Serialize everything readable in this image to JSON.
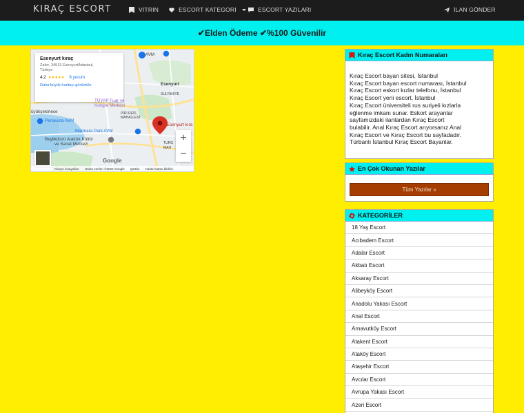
{
  "navbar": {
    "brand": "KIRAÇ ESCORT",
    "items": [
      {
        "label": "VITRIN",
        "icon": "bookmark-icon"
      },
      {
        "label": "ESCORT KATEGORI",
        "icon": "heart-icon"
      },
      {
        "label": "ESCORT YAZILARI",
        "icon": "comment-icon"
      },
      {
        "label": "İLAN GÖNDER",
        "icon": "paper-plane-icon"
      }
    ]
  },
  "banner": {
    "text": "✔Elden Ödeme ✔%100 Güvenilir"
  },
  "map": {
    "card": {
      "title": "Esenyurt kıraç",
      "address_line1": "Zafer, 34513 Esenyurt/İstanbul,",
      "address_line2": "Türkiye",
      "rating": "4,2",
      "stars": "★★★★★",
      "reviews": "6 yorum",
      "bigger_map": "Daha büyük haritayı görüntüle"
    },
    "labels": {
      "avm_top": "AVM",
      "esenyurt": "Esenyurt",
      "sultaniye": "SULTANİYE",
      "tuyap": "TÜYAP Fuar ve",
      "kongre": "Kongre Merkezi",
      "pirireis": "PİRİ REİS",
      "mahallesi": "MAHALLESİ",
      "buyukcekmece": "üyükçekmece",
      "perlavista": "Perlavista AVM",
      "marmara": "Marmara Park AVM",
      "pin_label": "Esenyurt kıra",
      "beylikduzu": "Beylikdüzü Atatürk Kültür",
      "sanat": "ve Sanat Merkezi",
      "turg": "TURG",
      "mah": "MAH"
    },
    "zoom_in": "+",
    "zoom_out": "−",
    "google": "Google",
    "attribution": [
      "Klavye kısayolları",
      "Harita verileri ©2024 Google",
      "Şartlar",
      "Harita hatası bildirin"
    ],
    "colors": {
      "water": "#a6d4f0",
      "land": "#eceff1",
      "park": "#cde8c8",
      "road": "#fde293",
      "pin": "#d93025"
    }
  },
  "sidebar": {
    "numbers": {
      "title": "Kıraç Escort Kadın Numaraları",
      "lines": [
        "Kıraç Escort bayan sitesi, İstanbul",
        "Kıraç Escort bayan escort numarası, İstanbul",
        "Kıraç Escort eskort kızlar telefonu, İstanbul",
        "Kıraç Escort yeni escort, İstanbul",
        "Kıraç Escort üniversiteli rus suriyeli kızlarla",
        "eğlenme imkanı sunar. Eskort arayanlar",
        "sayfamızdaki ilanlardan Kıraç Escort",
        "bulabilir. Anal Kıraç  Escort arıyorsanız Anal",
        "Kıraç Escort ve Kıraç Escort bu sayfadadır.",
        "Türbanlı İstanbul Kıraç Escort Bayanlar."
      ]
    },
    "popular": {
      "title": "En Çok Okunan Yazılar",
      "button": "Tüm Yazılar »"
    },
    "categories": {
      "title": "KATEGORİLER",
      "items": [
        "18 Yaş Escort",
        "Acıbadem Escort",
        "Adalar Escort",
        "Akbatı Escort",
        "Aksaray Escort",
        "Alibeyköy Escort",
        "Anadolu Yakası Escort",
        "Anal Escort",
        "Arnavutköy Escort",
        "Atakent Escort",
        "Ataköy Escort",
        "Ataşehir Escort",
        "Avcılar Escort",
        "Avrupa Yakası Escort",
        "Azeri Escort"
      ]
    },
    "accent": "#00f0f0"
  }
}
